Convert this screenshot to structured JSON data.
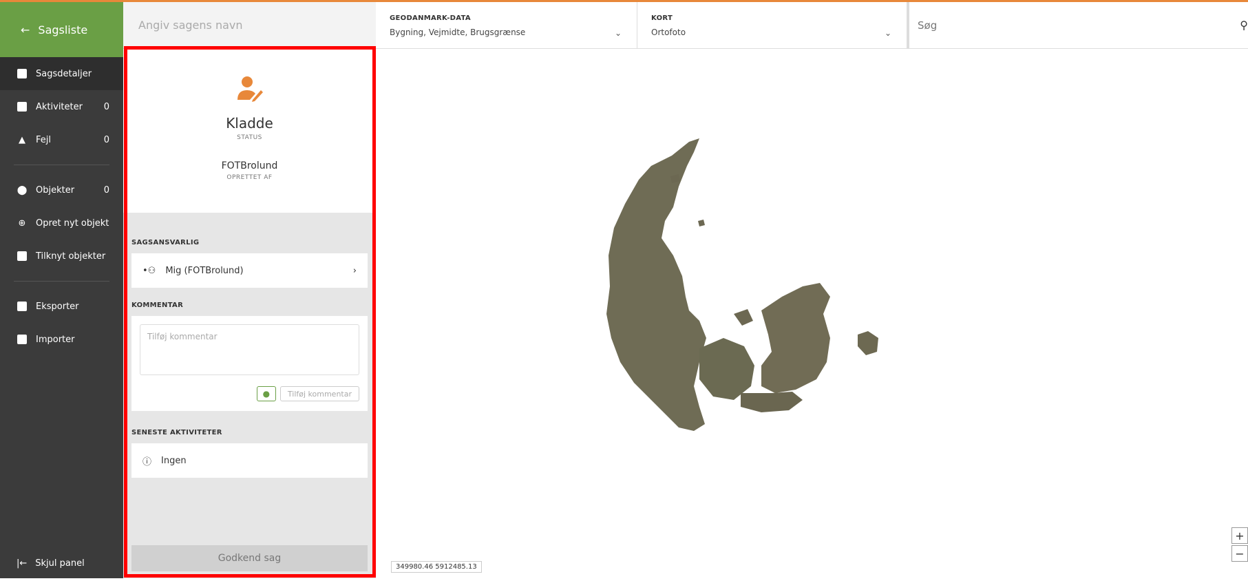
{
  "nav": {
    "back_label": "Sagsliste",
    "items": [
      {
        "label": "Sagsdetaljer",
        "count": ""
      },
      {
        "label": "Aktiviteter",
        "count": "0"
      },
      {
        "label": "Fejl",
        "count": "0"
      },
      {
        "label": "Objekter",
        "count": "0"
      },
      {
        "label": "Opret nyt objekt",
        "count": ""
      },
      {
        "label": "Tilknyt objekter",
        "count": ""
      },
      {
        "label": "Eksporter",
        "count": ""
      },
      {
        "label": "Importer",
        "count": ""
      }
    ],
    "hide_panel": "Skjul panel"
  },
  "case": {
    "name_placeholder": "Angiv sagens navn",
    "status": "Kladde",
    "status_label": "STATUS",
    "creator": "FOTBrolund",
    "creator_label": "OPRETTET AF",
    "responsible_label": "SAGSANSVARLIG",
    "responsible": "Mig (FOTBrolund)",
    "comment_label": "KOMMENTAR",
    "comment_placeholder": "Tilføj kommentar",
    "add_comment": "Tilføj kommentar",
    "activities_label": "SENESTE AKTIVITETER",
    "activities_value": "Ingen",
    "approve": "Godkend sag"
  },
  "topbar": {
    "geodata_label": "GEODANMARK-DATA",
    "geodata_value": "Bygning, Vejmidte, Brugsgrænse",
    "map_label": "KORT",
    "map_value": "Ortofoto",
    "search_placeholder": "Søg"
  },
  "map": {
    "coords": "349980.46 5912485.13",
    "zoom_in": "+",
    "zoom_out": "−"
  },
  "colors": {
    "accent_green": "#6a9f45",
    "accent_orange": "#e8883a",
    "highlight_red": "#ff0000"
  }
}
